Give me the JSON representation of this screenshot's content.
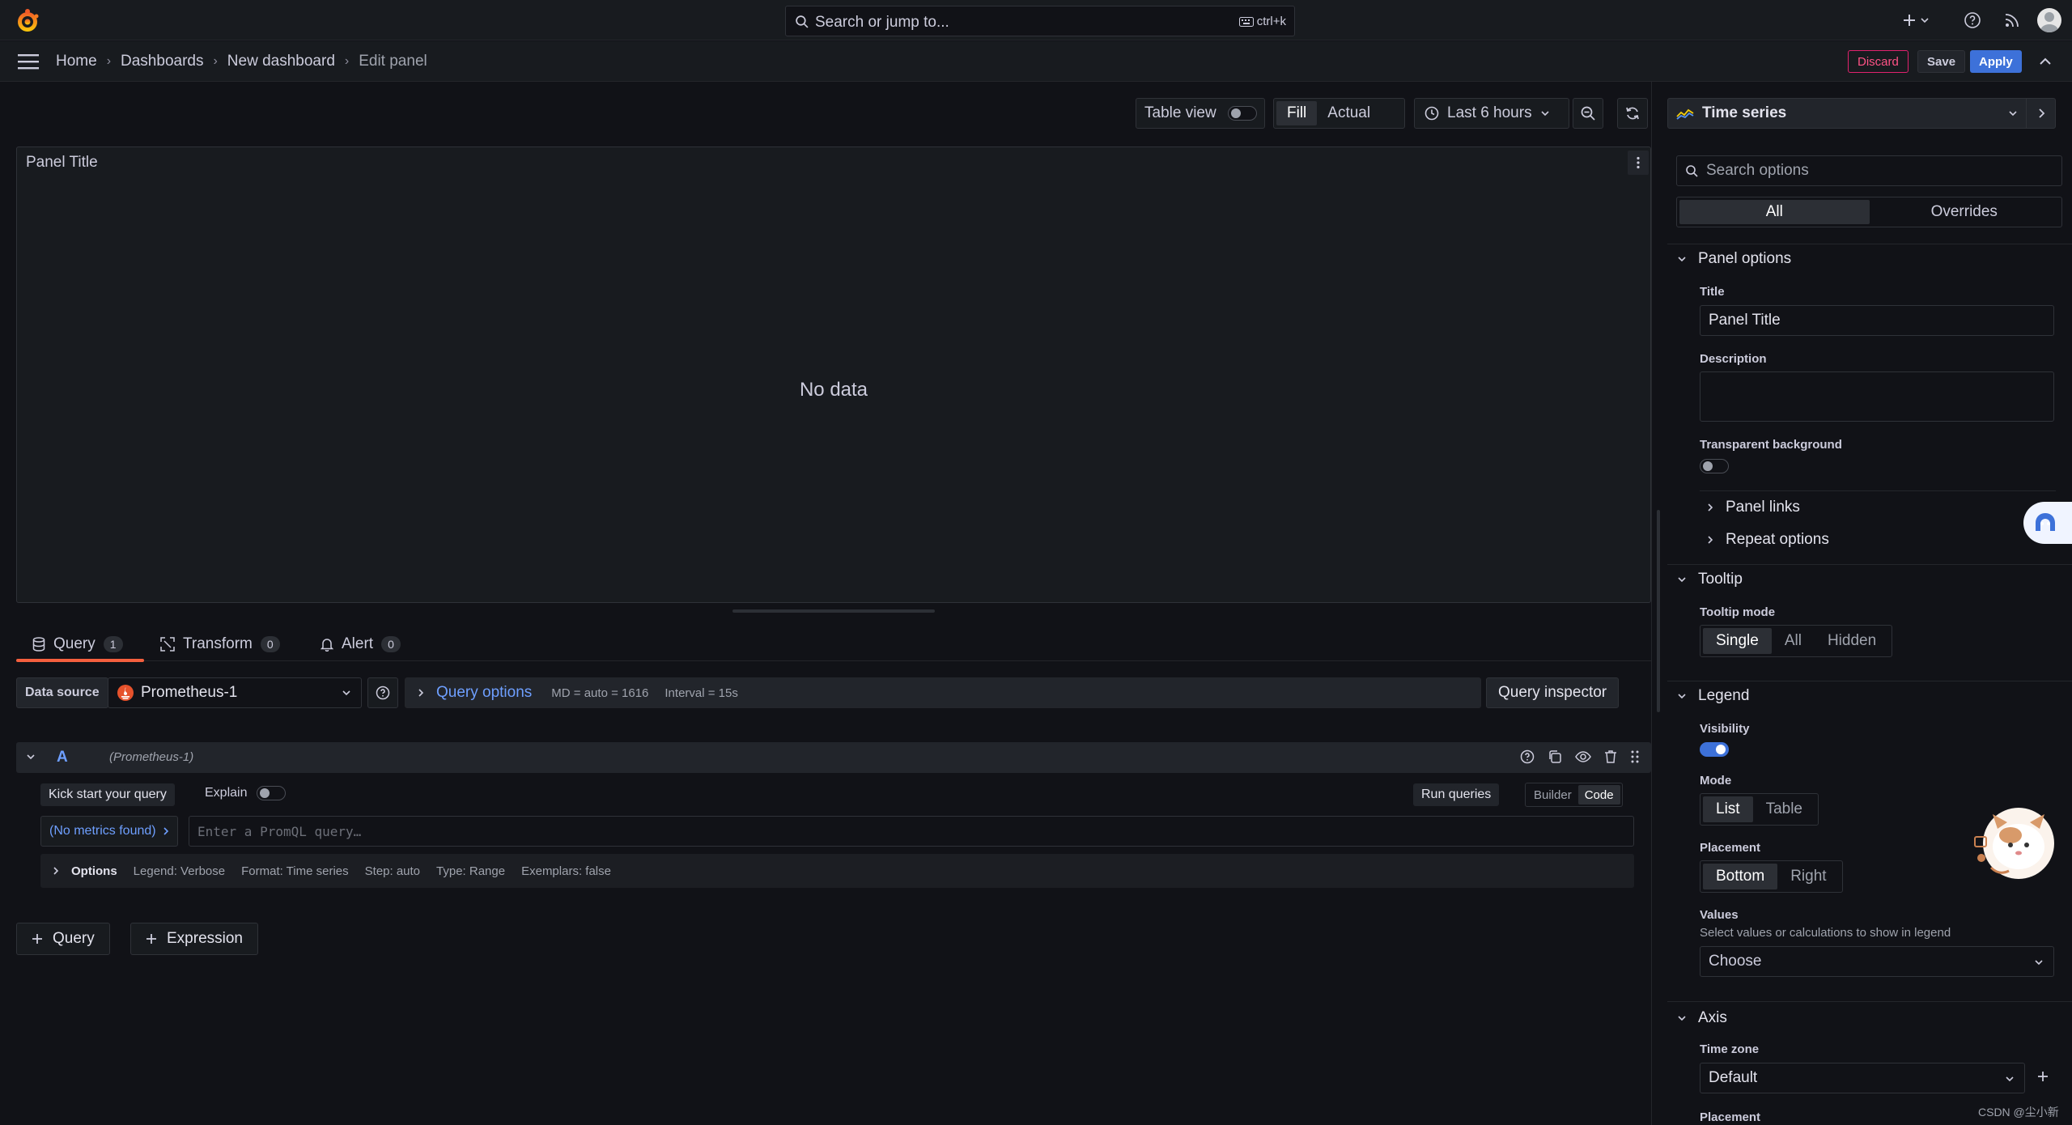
{
  "topbar": {
    "search_placeholder": "Search or jump to...",
    "search_shortcut": "ctrl+k"
  },
  "breadcrumb": {
    "items": [
      "Home",
      "Dashboards",
      "New dashboard"
    ],
    "current": "Edit panel"
  },
  "actions": {
    "discard": "Discard",
    "save": "Save",
    "apply": "Apply"
  },
  "panel_toolbar": {
    "table_view_label": "Table view",
    "table_view_enabled": false,
    "fill": "Fill",
    "actual": "Actual",
    "time_range": "Last 6 hours"
  },
  "viz_picker": {
    "selected": "Time series"
  },
  "panel": {
    "title": "Panel Title",
    "empty_message": "No data"
  },
  "query_tabs": [
    {
      "label": "Query",
      "count": "1"
    },
    {
      "label": "Transform",
      "count": "0"
    },
    {
      "label": "Alert",
      "count": "0"
    }
  ],
  "datasource": {
    "label": "Data source",
    "selected": "Prometheus-1",
    "query_options_label": "Query options",
    "md": "MD = auto = 1616",
    "interval": "Interval = 15s",
    "inspector_label": "Query inspector"
  },
  "query_a": {
    "ref": "A",
    "datasource": "(Prometheus-1)",
    "kickstart": "Kick start your query",
    "explain": "Explain",
    "run_queries": "Run queries",
    "editor_modes": [
      "Builder",
      "Code"
    ],
    "active_mode": "Code",
    "metrics_button": "(No metrics found)",
    "promql_placeholder": "Enter a PromQL query…",
    "options_label": "Options",
    "options_summary": [
      "Legend: Verbose",
      "Format: Time series",
      "Step: auto",
      "Type: Range",
      "Exemplars: false"
    ]
  },
  "add_buttons": {
    "query": "Query",
    "expression": "Expression"
  },
  "options_pane": {
    "search_placeholder": "Search options",
    "tabs": [
      "All",
      "Overrides"
    ],
    "panel_options": {
      "header": "Panel options",
      "title_label": "Title",
      "title_value": "Panel Title",
      "description_label": "Description",
      "transparent_label": "Transparent background",
      "panel_links": "Panel links",
      "repeat_options": "Repeat options"
    },
    "tooltip": {
      "header": "Tooltip",
      "mode_label": "Tooltip mode",
      "modes": [
        "Single",
        "All",
        "Hidden"
      ]
    },
    "legend": {
      "header": "Legend",
      "visibility_label": "Visibility",
      "visibility_on": true,
      "mode_label": "Mode",
      "modes": [
        "List",
        "Table"
      ],
      "placement_label": "Placement",
      "placements": [
        "Bottom",
        "Right"
      ],
      "values_label": "Values",
      "values_desc": "Select values or calculations to show in legend",
      "values_placeholder": "Choose"
    },
    "axis": {
      "header": "Axis",
      "timezone_label": "Time zone",
      "timezone_value": "Default",
      "placement_label": "Placement"
    }
  },
  "watermark": "CSDN @尘小新",
  "colors": {
    "background": "#111217",
    "accent_blue": "#3d71d9",
    "link_blue": "#6e9fff",
    "discard_red": "#e0226e",
    "tab_underline": "#f55f3e"
  }
}
